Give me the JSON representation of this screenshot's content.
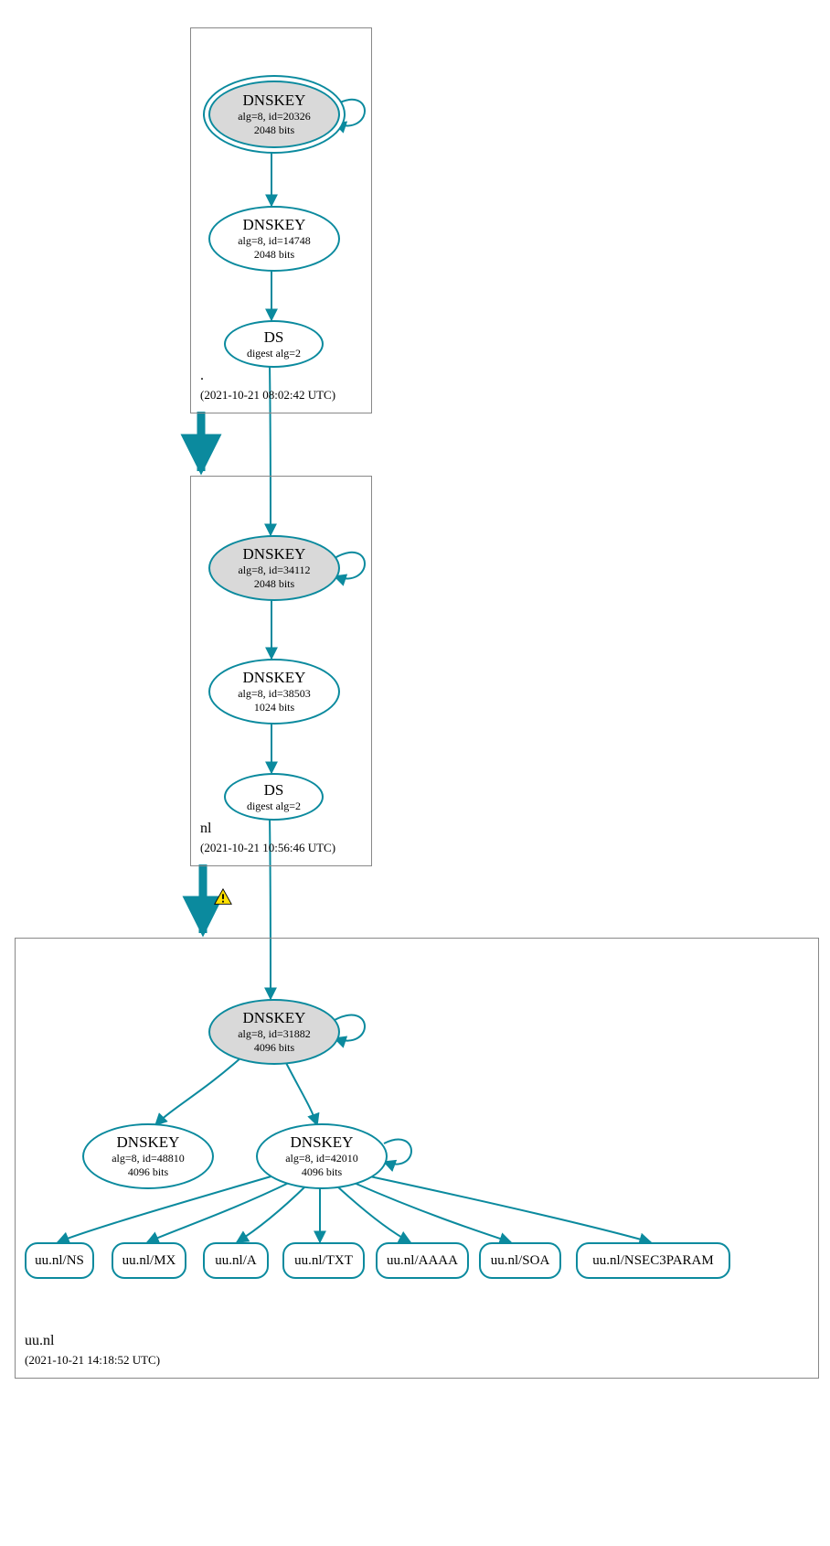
{
  "colors": {
    "accent": "#0b8a9e",
    "grey": "#d9d9d9"
  },
  "zones": {
    "root": {
      "label": ".",
      "timestamp": "(2021-10-21 08:02:42 UTC)"
    },
    "nl": {
      "label": "nl",
      "timestamp": "(2021-10-21 10:56:46 UTC)"
    },
    "uunl": {
      "label": "uu.nl",
      "timestamp": "(2021-10-21 14:18:52 UTC)"
    }
  },
  "nodes": {
    "root_ksk": {
      "title": "DNSKEY",
      "sub1": "alg=8, id=20326",
      "sub2": "2048 bits"
    },
    "root_zsk": {
      "title": "DNSKEY",
      "sub1": "alg=8, id=14748",
      "sub2": "2048 bits"
    },
    "root_ds": {
      "title": "DS",
      "sub1": "digest alg=2"
    },
    "nl_ksk": {
      "title": "DNSKEY",
      "sub1": "alg=8, id=34112",
      "sub2": "2048 bits"
    },
    "nl_zsk": {
      "title": "DNSKEY",
      "sub1": "alg=8, id=38503",
      "sub2": "1024 bits"
    },
    "nl_ds": {
      "title": "DS",
      "sub1": "digest alg=2"
    },
    "uu_ksk": {
      "title": "DNSKEY",
      "sub1": "alg=8, id=31882",
      "sub2": "4096 bits"
    },
    "uu_k2": {
      "title": "DNSKEY",
      "sub1": "alg=8, id=48810",
      "sub2": "4096 bits"
    },
    "uu_zsk": {
      "title": "DNSKEY",
      "sub1": "alg=8, id=42010",
      "sub2": "4096 bits"
    }
  },
  "rrsets": {
    "ns": "uu.nl/NS",
    "mx": "uu.nl/MX",
    "a": "uu.nl/A",
    "txt": "uu.nl/TXT",
    "aaaa": "uu.nl/AAAA",
    "soa": "uu.nl/SOA",
    "nsec": "uu.nl/NSEC3PARAM"
  }
}
